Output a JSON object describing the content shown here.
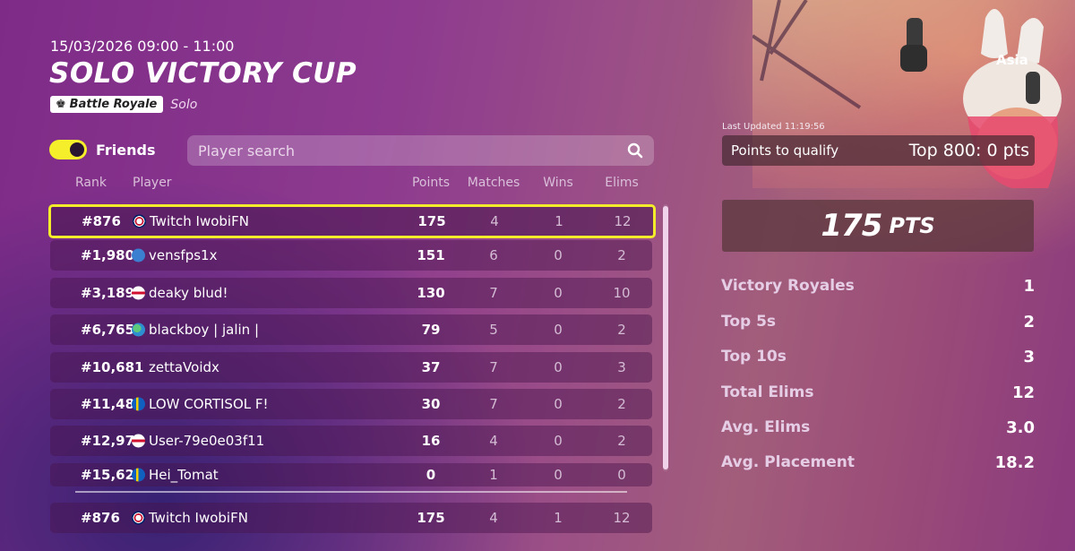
{
  "event": {
    "datetime": "15/03/2026 09:00 - 11:00",
    "title": "SOLO VICTORY CUP",
    "mode_badge": "Battle Royale",
    "mode_sub": "Solo"
  },
  "filters": {
    "friends_label": "Friends",
    "friends_toggle_on": true,
    "search_placeholder": "Player search"
  },
  "table": {
    "headers": {
      "rank": "Rank",
      "player": "Player",
      "points": "Points",
      "matches": "Matches",
      "wins": "Wins",
      "elims": "Elims"
    },
    "rows": [
      {
        "rank": "#876",
        "flag": "uk",
        "player": "Twitch IwobiFN",
        "points": "175",
        "matches": "4",
        "wins": "1",
        "elims": "12"
      },
      {
        "rank": "#1,980",
        "flag": "x",
        "player": "vensfps1x",
        "points": "151",
        "matches": "6",
        "wins": "0",
        "elims": "2"
      },
      {
        "rank": "#3,189",
        "flag": "en",
        "player": "deaky blud!",
        "points": "130",
        "matches": "7",
        "wins": "0",
        "elims": "10"
      },
      {
        "rank": "#6,765",
        "flag": "globe",
        "player": "blackboy | jalin |",
        "points": "79",
        "matches": "5",
        "wins": "0",
        "elims": "2"
      },
      {
        "rank": "#10,681",
        "flag": "none",
        "player": "zettaVoidx",
        "points": "37",
        "matches": "7",
        "wins": "0",
        "elims": "3"
      },
      {
        "rank": "#11,487",
        "flag": "se",
        "player": "LOW CORTISOL F!",
        "points": "30",
        "matches": "7",
        "wins": "0",
        "elims": "2"
      },
      {
        "rank": "#12,972",
        "flag": "en",
        "player": "User-79e0e03f11",
        "points": "16",
        "matches": "4",
        "wins": "0",
        "elims": "2"
      },
      {
        "rank": "#15,621",
        "flag": "se",
        "player": "Hei_Tomat",
        "points": "0",
        "matches": "1",
        "wins": "0",
        "elims": "0"
      }
    ],
    "self_row": {
      "rank": "#876",
      "flag": "uk",
      "player": "Twitch IwobiFN",
      "points": "175",
      "matches": "4",
      "wins": "1",
      "elims": "12"
    }
  },
  "panel": {
    "region": "Asia",
    "last_updated": "Last Updated 11:19:56",
    "qualify_label": "Points to qualify",
    "qualify_value": "Top 800: 0 pts",
    "total_points": "175",
    "points_unit": "PTS",
    "stats": [
      {
        "label": "Victory Royales",
        "value": "1"
      },
      {
        "label": "Top 5s",
        "value": "2"
      },
      {
        "label": "Top 10s",
        "value": "3"
      },
      {
        "label": "Total Elims",
        "value": "12"
      },
      {
        "label": "Avg. Elims",
        "value": "3.0"
      },
      {
        "label": "Avg. Placement",
        "value": "18.2"
      }
    ]
  },
  "colors": {
    "highlight": "#f3ec2a",
    "toggle": "#f5ee2a"
  }
}
